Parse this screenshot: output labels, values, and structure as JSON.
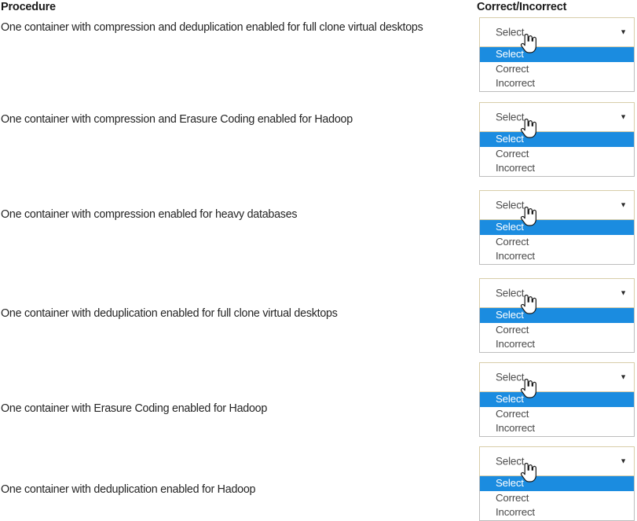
{
  "headers": {
    "procedure": "Procedure",
    "correct_incorrect": "Correct/Incorrect"
  },
  "colors": {
    "page_background": "#ffffff",
    "dropdown_border": "#d8cda9",
    "list_border": "#bdbdbd",
    "highlight_background": "#1b8ce0",
    "highlight_text": "#ffffff",
    "text": "#242424",
    "value_text": "#4f4f4f"
  },
  "dropdown_options": {
    "select": "Select",
    "correct": "Correct",
    "incorrect": "Incorrect"
  },
  "icons": {
    "chevron_down": "▼",
    "cursor": "pointing-hand-cursor"
  },
  "rows": [
    {
      "procedure": "One container with compression and deduplication enabled for full clone virtual desktops",
      "dropdown": {
        "selected_value": "Select",
        "expanded": true,
        "highlighted_option": "Select",
        "options": [
          "Select",
          "Correct",
          "Incorrect"
        ]
      }
    },
    {
      "procedure": "One container with compression and Erasure Coding enabled for Hadoop",
      "dropdown": {
        "selected_value": "Select",
        "expanded": true,
        "highlighted_option": "Select",
        "options": [
          "Select",
          "Correct",
          "Incorrect"
        ]
      }
    },
    {
      "procedure": "One container with compression enabled for heavy databases",
      "dropdown": {
        "selected_value": "Select",
        "expanded": true,
        "highlighted_option": "Select",
        "options": [
          "Select",
          "Correct",
          "Incorrect"
        ]
      }
    },
    {
      "procedure": "One container with deduplication enabled for full clone virtual desktops",
      "dropdown": {
        "selected_value": "Select",
        "expanded": true,
        "highlighted_option": "Select",
        "options": [
          "Select",
          "Correct",
          "Incorrect"
        ]
      }
    },
    {
      "procedure": "One container with Erasure Coding enabled for Hadoop",
      "dropdown": {
        "selected_value": "Select",
        "expanded": true,
        "highlighted_option": "Select",
        "options": [
          "Select",
          "Correct",
          "Incorrect"
        ]
      }
    },
    {
      "procedure": "One container with deduplication enabled for Hadoop",
      "dropdown": {
        "selected_value": "Select",
        "expanded": true,
        "highlighted_option": "Select",
        "options": [
          "Select",
          "Correct",
          "Incorrect"
        ]
      }
    }
  ],
  "layout": {
    "procedure_tops": [
      26,
      143,
      264,
      390,
      511,
      614
    ],
    "dropdown_tops": [
      22,
      130,
      242,
      354,
      461,
      568
    ]
  }
}
